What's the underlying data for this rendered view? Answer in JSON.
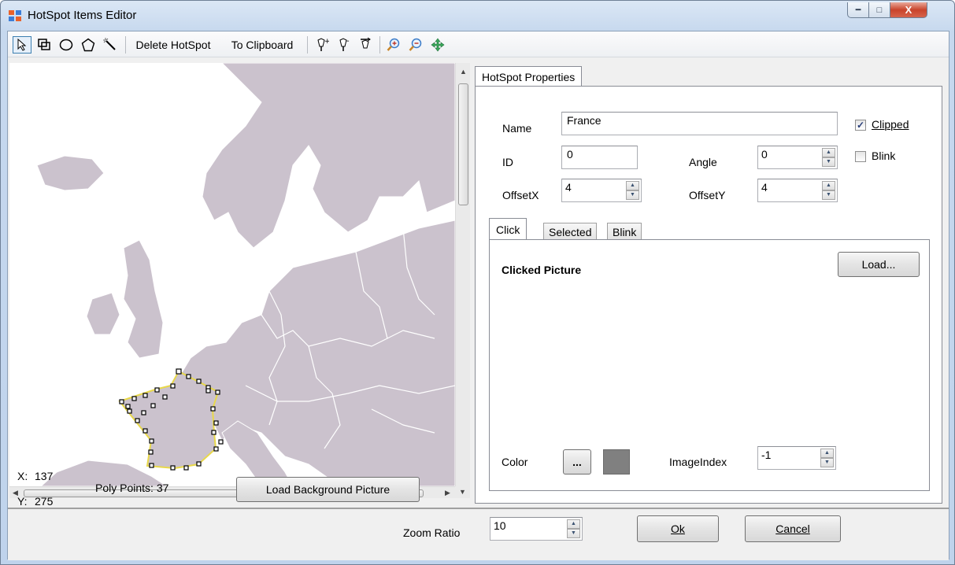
{
  "window": {
    "title": "HotSpot Items Editor"
  },
  "toolbar": {
    "delete_label": "Delete HotSpot",
    "clipboard_label": "To Clipboard"
  },
  "status": {
    "x_label": "X:",
    "x_value": "137",
    "y_label": "Y:",
    "y_value": "275",
    "poly_points": "Poly Points: 37",
    "load_bg_label": "Load Background Picture"
  },
  "props": {
    "tab_label": "HotSpot Properties",
    "name_label": "Name",
    "name_value": "France",
    "id_label": "ID",
    "id_value": "0",
    "angle_label": "Angle",
    "angle_value": "0",
    "offsetx_label": "OffsetX",
    "offsetx_value": "4",
    "offsety_label": "OffsetY",
    "offsety_value": "4",
    "clipped_label": "Clipped",
    "clipped_checked": true,
    "blink_label": "Blink",
    "blink_checked": false
  },
  "state_tabs": {
    "tabs": [
      "Click",
      "Selected",
      "Blink"
    ],
    "active": "Click",
    "clicked_picture_label": "Clicked Picture",
    "load_label": "Load...",
    "color_label": "Color",
    "color_button_label": "...",
    "color_value": "#808080",
    "imageindex_label": "ImageIndex",
    "imageindex_value": "-1"
  },
  "footer": {
    "zoom_label": "Zoom Ratio",
    "zoom_value": "10",
    "ok_label": "Ok",
    "cancel_label": "Cancel"
  }
}
